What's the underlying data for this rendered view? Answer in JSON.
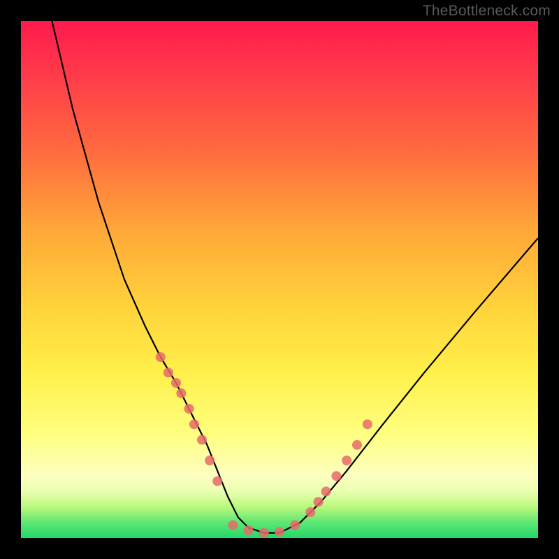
{
  "watermark": "TheBottleneck.com",
  "chart_data": {
    "type": "line",
    "title": "",
    "xlabel": "",
    "ylabel": "",
    "xlim": [
      0,
      100
    ],
    "ylim": [
      0,
      100
    ],
    "curve": {
      "x": [
        6,
        10,
        15,
        20,
        24,
        27,
        30,
        32,
        34,
        36,
        38,
        40,
        42,
        44,
        47,
        50,
        54,
        58,
        63,
        70,
        78,
        88,
        100
      ],
      "y": [
        100,
        83,
        65,
        50,
        41,
        35,
        30,
        26,
        22,
        18,
        13,
        8,
        4,
        2,
        1,
        1,
        3,
        7,
        13,
        22,
        32,
        44,
        58
      ]
    },
    "marker_clusters": {
      "left_arm": {
        "x": [
          27,
          28.5,
          30,
          31,
          32.5,
          33.5,
          35,
          36.5,
          38
        ],
        "y": [
          35,
          32,
          30,
          28,
          25,
          22,
          19,
          15,
          11
        ]
      },
      "right_arm": {
        "x": [
          56,
          57.5,
          59,
          61,
          63,
          65,
          67
        ],
        "y": [
          5,
          7,
          9,
          12,
          15,
          18,
          22
        ]
      },
      "bottom": {
        "x": [
          41,
          44,
          47,
          50,
          53
        ],
        "y": [
          2.5,
          1.5,
          1,
          1.2,
          2.5
        ]
      }
    },
    "marker_color": "#e86a6a",
    "curve_color": "#000000"
  }
}
